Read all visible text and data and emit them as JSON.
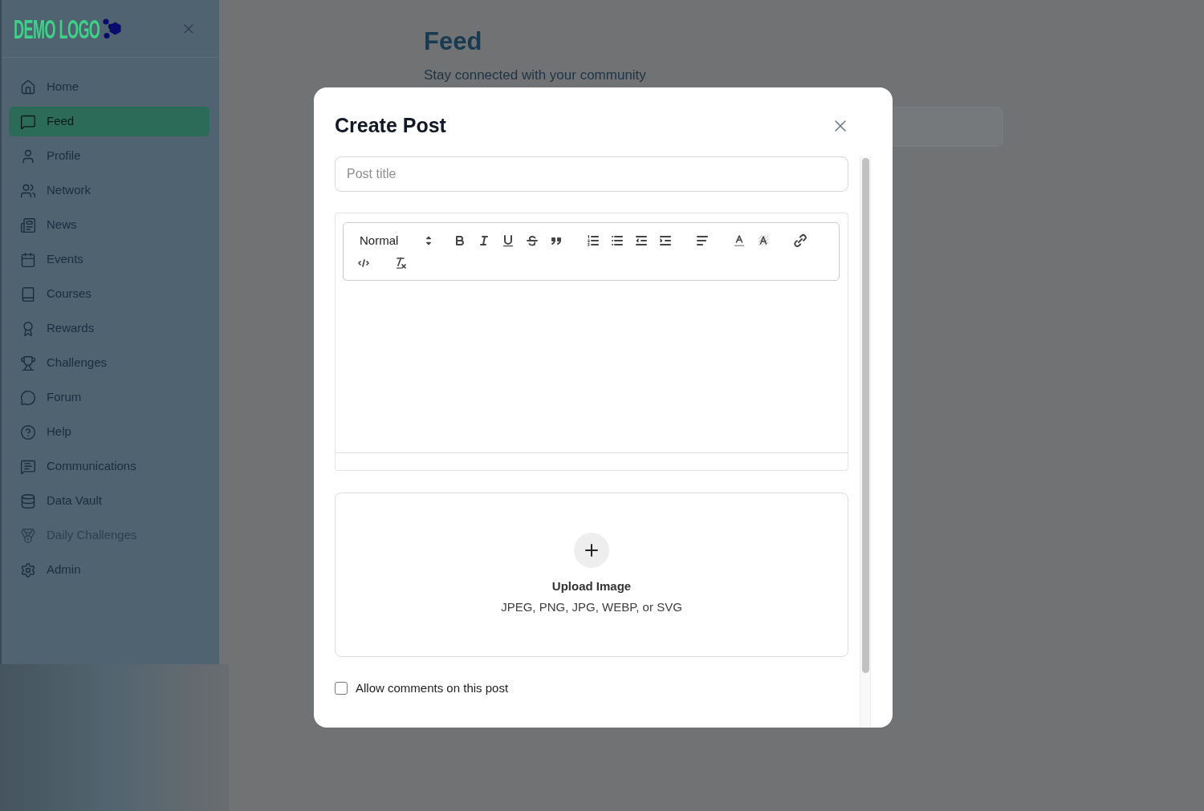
{
  "sidebar": {
    "logo": "DEMO LOGO",
    "items": [
      {
        "label": "Home",
        "selected": false,
        "disabled": false
      },
      {
        "label": "Feed",
        "selected": true,
        "disabled": false
      },
      {
        "label": "Profile",
        "selected": false,
        "disabled": false
      },
      {
        "label": "Network",
        "selected": false,
        "disabled": false
      },
      {
        "label": "News",
        "selected": false,
        "disabled": false
      },
      {
        "label": "Events",
        "selected": false,
        "disabled": false
      },
      {
        "label": "Courses",
        "selected": false,
        "disabled": false
      },
      {
        "label": "Rewards",
        "selected": false,
        "disabled": false
      },
      {
        "label": "Challenges",
        "selected": false,
        "disabled": false
      },
      {
        "label": "Forum",
        "selected": false,
        "disabled": false
      },
      {
        "label": "Help",
        "selected": false,
        "disabled": false
      },
      {
        "label": "Communications",
        "selected": false,
        "disabled": false
      },
      {
        "label": "Data Vault",
        "selected": false,
        "disabled": false
      },
      {
        "label": "Daily Challenges",
        "selected": false,
        "disabled": true
      },
      {
        "label": "Admin",
        "selected": false,
        "disabled": false
      }
    ]
  },
  "page": {
    "title": "Feed",
    "subtitle": "Stay connected with your community"
  },
  "dialog": {
    "title": "Create Post",
    "title_field": {
      "placeholder": "Post title"
    },
    "editor": {
      "format": "Normal"
    },
    "upload": {
      "label": "Upload Image",
      "hint": "JPEG, PNG, JPG, WEBP, or SVG"
    },
    "allow_comments": {
      "label": "Allow comments on this post",
      "checked": false
    }
  }
}
